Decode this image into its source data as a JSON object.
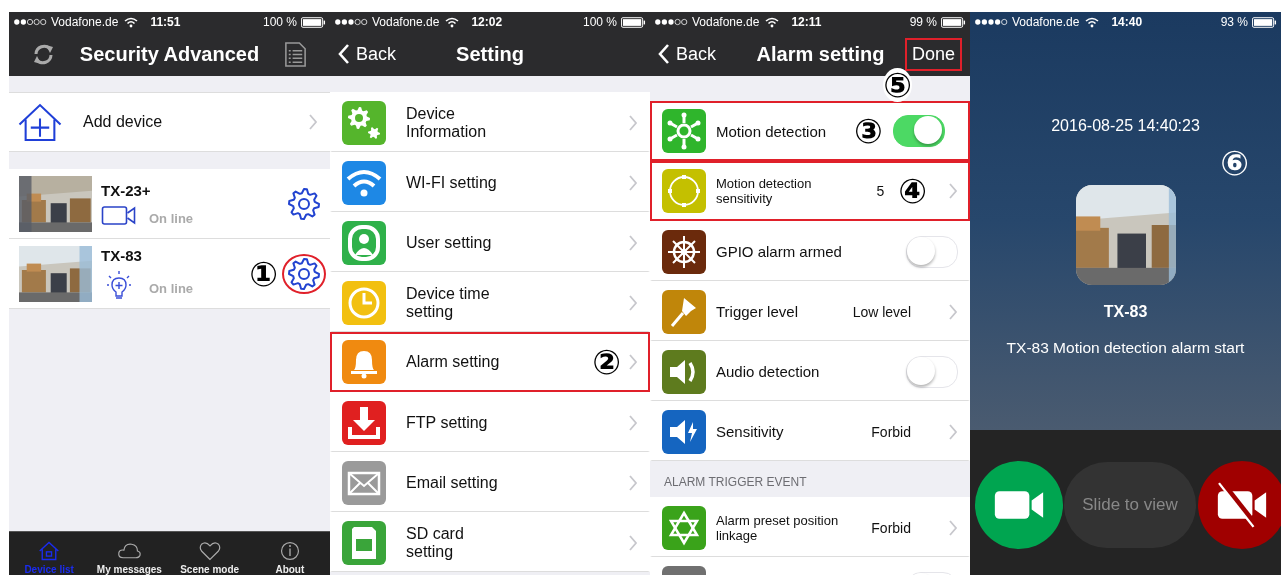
{
  "panels": [
    {
      "kind": "device_list",
      "status_bar": {
        "carrier": "Vodafone.de",
        "time": "11:51",
        "battery": "100 %"
      },
      "title": "Security Advanced",
      "add_device": "Add device",
      "devices": [
        {
          "name": "TX-23+",
          "status": "On line",
          "highlighted": false
        },
        {
          "name": "TX-83",
          "status": "On line",
          "highlighted": true,
          "annotation": "①"
        }
      ],
      "tabs": [
        {
          "label": "Device list",
          "selected": true
        },
        {
          "label": "My messages",
          "selected": false
        },
        {
          "label": "Scene mode",
          "selected": false
        },
        {
          "label": "About",
          "selected": false
        }
      ]
    },
    {
      "kind": "settings",
      "status_bar": {
        "carrier": "Vodafone.de",
        "time": "12:02",
        "battery": "100 %"
      },
      "back": "Back",
      "title": "Setting",
      "rows": [
        {
          "kind": "link",
          "label": "Device Information",
          "color": "#55b52c",
          "highlighted": false
        },
        {
          "kind": "link",
          "label": "WI-FI setting",
          "color": "#1e88e5",
          "highlighted": false
        },
        {
          "kind": "link",
          "label": "User setting",
          "color": "#2fb14a",
          "highlighted": false
        },
        {
          "kind": "link",
          "label": "Device time setting",
          "color": "#f2c010",
          "highlighted": false
        },
        {
          "kind": "link",
          "label": "Alarm setting",
          "color": "#f08a10",
          "highlighted": true,
          "annotation": "②"
        },
        {
          "kind": "link",
          "label": "FTP setting",
          "color": "#e02020",
          "highlighted": false
        },
        {
          "kind": "link",
          "label": "Email setting",
          "color": "#9a9a9a",
          "highlighted": false
        },
        {
          "kind": "link",
          "label": "SD card setting",
          "color": "#3aa53a",
          "highlighted": false
        }
      ]
    },
    {
      "kind": "settings",
      "status_bar": {
        "carrier": "Vodafone.de",
        "time": "12:11",
        "battery": "99 %"
      },
      "back": "Back",
      "title": "Alarm setting",
      "done": {
        "label": "Done",
        "highlighted": true,
        "annotation": "⑤"
      },
      "rows": [
        {
          "kind": "toggle",
          "label": "Motion detection",
          "on": true,
          "color": "#2fb52c",
          "highlighted": true,
          "annotation": "③"
        },
        {
          "kind": "value",
          "label": "Motion detection sensitivity",
          "value": "5",
          "color": "#c4c000",
          "highlighted": true,
          "annotation": "④"
        },
        {
          "kind": "toggle",
          "label": "GPIO alarm armed",
          "on": false,
          "color": "#6b2a0c",
          "highlighted": false
        },
        {
          "kind": "value",
          "label": "Trigger level",
          "value": "Low level",
          "color": "#c0860a",
          "highlighted": false
        },
        {
          "kind": "toggle",
          "label": "Audio detection",
          "on": false,
          "color": "#5e7b1e",
          "highlighted": false
        },
        {
          "kind": "value",
          "label": "Sensitivity",
          "value": "Forbid",
          "color": "#1565c0",
          "highlighted": false
        },
        {
          "kind": "section",
          "label": "ALARM TRIGGER EVENT"
        },
        {
          "kind": "value",
          "label": "Alarm preset position linkage",
          "value": "Forbid",
          "color": "#3aa31a",
          "highlighted": false
        },
        {
          "kind": "toggle",
          "on": false,
          "color": "#707070",
          "highlighted": false
        }
      ]
    },
    {
      "kind": "alert",
      "status_bar": {
        "carrier": "Vodafone.de",
        "time": "14:40",
        "battery": "93 %"
      },
      "timestamp": "2016-08-25 14:40:23",
      "annotation": "⑥",
      "device": "TX-83",
      "message": "TX-83 Motion detection alarm start",
      "slider": "Slide to view"
    }
  ]
}
